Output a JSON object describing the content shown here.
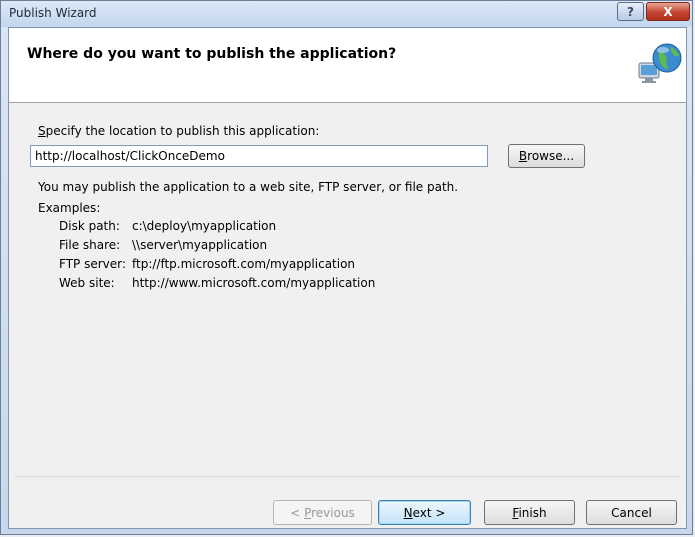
{
  "window": {
    "title": "Publish Wizard",
    "help_glyph": "?",
    "close_glyph": "X"
  },
  "header": {
    "title": "Where do you want to publish the application?",
    "icon": "globe-computer-icon"
  },
  "location": {
    "label_accel": "S",
    "label_rest": "pecify the location to publish this application:",
    "value": "http://localhost/ClickOnceDemo",
    "browse_accel": "B",
    "browse_rest": "rowse..."
  },
  "info": "You may publish the application to a web site, FTP server, or file path.",
  "examples": {
    "heading": "Examples:",
    "rows": [
      {
        "key": "Disk path:",
        "value": "c:\\deploy\\myapplication"
      },
      {
        "key": "File share:",
        "value": "\\\\server\\myapplication"
      },
      {
        "key": "FTP server:",
        "value": "ftp://ftp.microsoft.com/myapplication"
      },
      {
        "key": "Web site:",
        "value": "http://www.microsoft.com/myapplication"
      }
    ]
  },
  "buttons": {
    "previous_pre": "< ",
    "previous_accel": "P",
    "previous_rest": "revious",
    "next_accel": "N",
    "next_rest": "ext >",
    "finish_accel": "F",
    "finish_rest": "inish",
    "cancel": "Cancel"
  }
}
